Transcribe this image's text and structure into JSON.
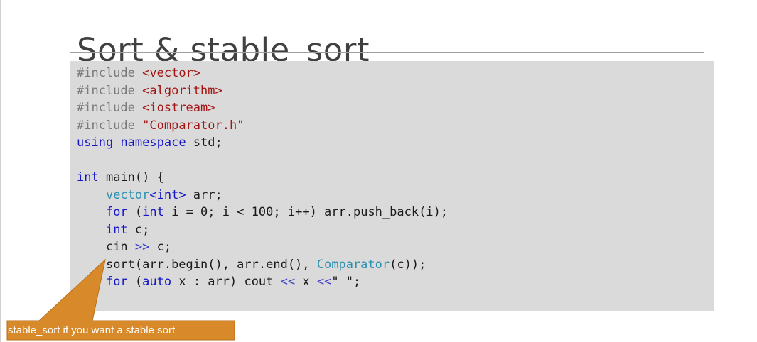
{
  "slide": {
    "title": "Sort & stable_sort",
    "callout_text": "stable_sort if you want a stable sort"
  },
  "code": {
    "l1": {
      "kw": "#include",
      "arg": "<vector>"
    },
    "l2": {
      "kw": "#include",
      "arg": "<algorithm>"
    },
    "l3": {
      "kw": "#include",
      "arg": "<iostream>"
    },
    "l4": {
      "kw": "#include",
      "arg": "\"Comparator.h\""
    },
    "l5": {
      "a": "using",
      "b": "namespace",
      "c": "std;"
    },
    "l7": {
      "a": "int",
      "b": "main() {"
    },
    "l8": {
      "a": "vector",
      "b": "<int>",
      "c": " arr;"
    },
    "l9": {
      "a": "for",
      "b": " (",
      "c": "int",
      "d": " i = 0; i < 100; i++) arr.push_back(i);"
    },
    "l10": {
      "a": "int",
      "b": " c;"
    },
    "l11": {
      "a": "cin ",
      "b": ">>",
      "c": " c;"
    },
    "l12": {
      "a": "sort(arr.begin(), arr.end(), ",
      "b": "Comparator",
      "c": "(c));"
    },
    "l13": {
      "a": "for",
      "b": " (",
      "c": "auto",
      "d": " x : arr) cout ",
      "e": "<<",
      "f": " x ",
      "g": "<<",
      "h": "\" \";"
    }
  },
  "colors": {
    "code_background": "#dadada",
    "callout": "#d88a2a",
    "keyword": "#1515c8",
    "string": "#a31515",
    "type": "#2b91af"
  }
}
